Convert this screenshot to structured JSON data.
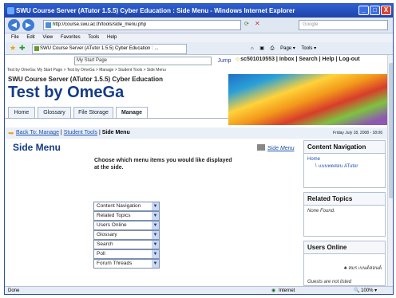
{
  "window": {
    "title": "SWU Course Server (ATutor 1.5.5) Cyber Education : Side Menu - Windows Internet Explorer",
    "buttons": [
      "_",
      "□",
      "X"
    ]
  },
  "address": {
    "url": "http://course.swu.ac.th/tools/side_menu.php",
    "search_placeholder": "Google"
  },
  "menubar": [
    "File",
    "Edit",
    "View",
    "Favorites",
    "Tools",
    "Help"
  ],
  "favbar": {
    "tab_label": "SWU Course Server (ATutor 1.5.5) Cyber Education : ...",
    "tools": [
      "Page ▾",
      "Tools ▾"
    ]
  },
  "page": {
    "jump": {
      "selected": "My Start Page",
      "button": "Jump"
    },
    "user_links": "sc501010553 | Inbox | Search | Help | Log-out",
    "crumb": "Test by OmeGa: My Start Page > Test by OmeGa > Manage > Student Tools > Side Menu",
    "site_title": "SWU Course Server (ATutor 1.5.5) Cyber Education",
    "course_title": "Test by OmeGa",
    "tabs": [
      "Home",
      "Glossary",
      "File Storage",
      "Manage"
    ],
    "back": {
      "back_link": "Back To: Manage",
      "sep1": "|",
      "student_tools": "Student Tools",
      "sep2": "|",
      "current": "Side Menu"
    },
    "date": "Friday July 18, 2008 - 18:06",
    "title": "Side Menu",
    "side_menu_link": "Side Menu",
    "instructions": "Choose which menu items you would like displayed at the side.",
    "selects": [
      "Content Navigation",
      "Related Topics",
      "Users Online",
      "Glossary",
      "Search",
      "Poll",
      "Forum Threads"
    ]
  },
  "panels": {
    "content_nav": {
      "title": "Content Navigation",
      "home": "Home",
      "item": "แบบทดสอบ ATutor"
    },
    "related": {
      "title": "Related Topics",
      "body": "None Found."
    },
    "users": {
      "title": "Users Online",
      "user": "สมร เบนต์สอนต์",
      "guests": "Guests are not listed"
    }
  },
  "status": {
    "left": "Done",
    "zone": "Internet",
    "zoom": "100%"
  }
}
